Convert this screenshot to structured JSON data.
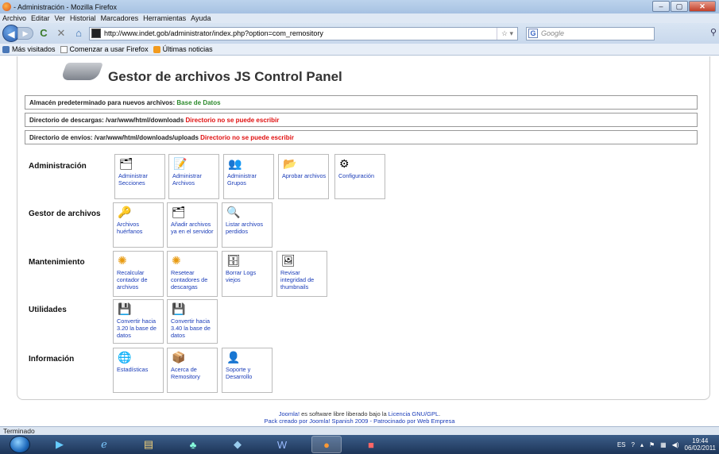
{
  "window": {
    "title": "- Administración - Mozilla Firefox",
    "min": "–",
    "max": "▢",
    "close": "✕"
  },
  "menubar": [
    "Archivo",
    "Editar",
    "Ver",
    "Historial",
    "Marcadores",
    "Herramientas",
    "Ayuda"
  ],
  "nav": {
    "url": "http://www.indet.gob/administrator/index.php?option=com_remository",
    "search_placeholder": "Google",
    "search_engine": "G"
  },
  "bookmarks": [
    "Más visitados",
    "Comenzar a usar Firefox",
    "Últimas noticias"
  ],
  "page": {
    "title": "Gestor de archivos JS Control Panel",
    "info": [
      {
        "label": "Almacén predeterminado para nuevos archivos:",
        "value": "Base de Datos",
        "status": "ok"
      },
      {
        "label": "Directorio de descargas: /var/www/html/downloads",
        "value": "Directorio no se puede escribir",
        "status": "err"
      },
      {
        "label": "Directorio de envíos: /var/www/html/downloads/uploads",
        "value": "Directorio no se puede escribir",
        "status": "err"
      }
    ],
    "sections": [
      {
        "label": "Administración",
        "tiles": [
          {
            "icon": "folder-icon",
            "glyph": "🗂",
            "label": "Administrar Secciones"
          },
          {
            "icon": "files-icon",
            "glyph": "📝",
            "label": "Administrar Archivos"
          },
          {
            "icon": "group-icon",
            "glyph": "👥",
            "label": "Administrar Grupos"
          },
          {
            "icon": "approve-folder-icon",
            "glyph": "📂",
            "label": "Aprobar archivos"
          },
          {
            "icon": "config-icon",
            "glyph": "⚙",
            "label": "Configuración"
          }
        ]
      },
      {
        "label": "Gestor de archivos",
        "tiles": [
          {
            "icon": "orphan-files-icon",
            "glyph": "🔑",
            "label": "Archivos huérfanos"
          },
          {
            "icon": "add-files-icon",
            "glyph": "🗂",
            "label": "Añadir archivos ya en el servidor"
          },
          {
            "icon": "lost-files-icon",
            "glyph": "🔍",
            "label": "Listar archivos perdidos"
          }
        ]
      },
      {
        "label": "Mantenimiento",
        "tiles": [
          {
            "icon": "recalc-icon",
            "glyph": "✺",
            "label": "Recalcular contador de archivos"
          },
          {
            "icon": "reset-icon",
            "glyph": "✺",
            "label": "Resetear contadores de descargas"
          },
          {
            "icon": "delete-logs-icon",
            "glyph": "🗄",
            "label": "Borrar Logs viejos"
          },
          {
            "icon": "thumbnails-icon",
            "glyph": "🖼",
            "label": "Revisar integridad de thumbnails"
          }
        ]
      },
      {
        "label": "Utilidades",
        "tiles": [
          {
            "icon": "convert-icon",
            "glyph": "💾",
            "label": "Convertir hacia 3.20 la base de datos"
          },
          {
            "icon": "convert-icon",
            "glyph": "💾",
            "label": "Convertir hacia 3.40 la base de datos"
          }
        ]
      },
      {
        "label": "Información",
        "tiles": [
          {
            "icon": "stats-icon",
            "glyph": "🌐",
            "label": "Estadísticas"
          },
          {
            "icon": "about-icon",
            "glyph": "📦",
            "label": "Acerca de Remository"
          },
          {
            "icon": "support-icon",
            "glyph": "👤",
            "label": "Soporte y Desarrollo"
          }
        ]
      }
    ],
    "footer": {
      "line1_link": "Joomla!",
      "line1_text": " es software libre liberado bajo la ",
      "line1_link2": "Licencia GNU/GPL",
      "line1_end": ".",
      "line2": "Pack creado por Joomla! Spanish 2009 - Patrocinado por Web Empresa"
    }
  },
  "status": "Terminado",
  "taskbar": {
    "lang": "ES",
    "time": "19:44",
    "date": "06/02/2011"
  }
}
